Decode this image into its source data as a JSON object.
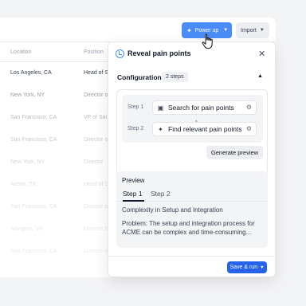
{
  "toolbar": {
    "power_up_label": "Power up",
    "import_label": "Import"
  },
  "table": {
    "headers": [
      "Location",
      "Position"
    ],
    "rows": [
      {
        "location": "Los Angeles, CA",
        "position": "Head of S"
      },
      {
        "location": "New York, NY",
        "position": "Director o"
      },
      {
        "location": "San Francisco, CA",
        "position": "VP of Sal"
      },
      {
        "location": "San Francisco, CA",
        "position": "Director o"
      },
      {
        "location": "New York, NY",
        "position": "Director"
      },
      {
        "location": "Austin, TX",
        "position": "Head of S"
      },
      {
        "location": "San Francisco, CA",
        "position": "Director o"
      },
      {
        "location": "Arlington, VA",
        "position": "Director o"
      },
      {
        "location": "San Francisco, CA",
        "position": "Director o"
      }
    ]
  },
  "panel": {
    "title": "Reveal pain points",
    "configuration_label": "Configuration",
    "steps_badge": "2 steps",
    "steps": [
      {
        "label": "Step 1",
        "name": "Search for pain points"
      },
      {
        "label": "Step 2",
        "name": "Find relevant pain points"
      }
    ],
    "generate_preview_label": "Generate preview",
    "preview": {
      "title": "Preview",
      "tabs": [
        "Step 1",
        "Step 2"
      ],
      "heading": "Complexity in Setup and Integration",
      "body": "Problem: The setup and integration process for ACME can be complex and time-consuming..."
    },
    "save_run_label": "Save & run"
  },
  "colors": {
    "accent": "#4a8cf7",
    "primary_button": "#2563eb"
  }
}
